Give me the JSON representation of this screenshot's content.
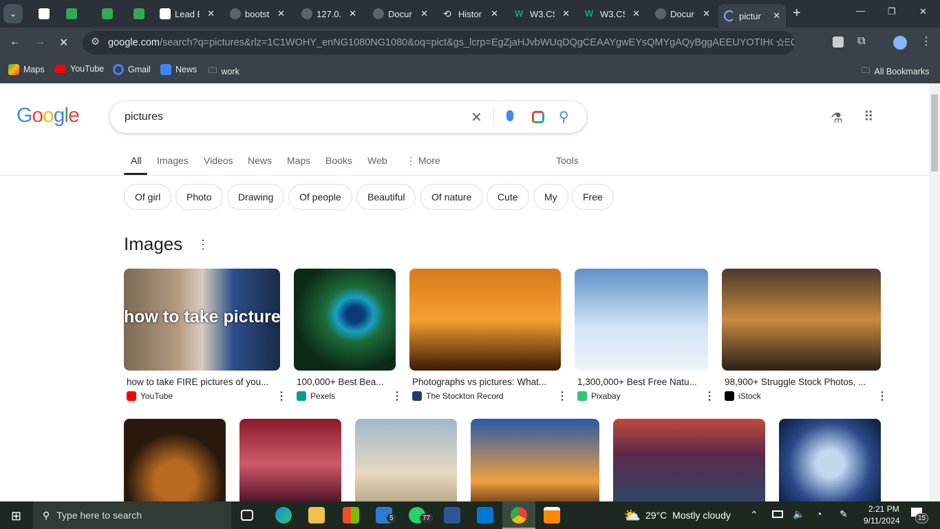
{
  "browser": {
    "tabs": [
      {
        "label": "",
        "icon": "adp-icon"
      },
      {
        "label": "",
        "icon": "sheets-icon"
      },
      {
        "label": "",
        "icon": "sheets-icon"
      },
      {
        "label": "",
        "icon": "sheets-icon"
      },
      {
        "label": "Lead E",
        "icon": "lead-icon"
      },
      {
        "label": "bootst",
        "icon": "globe-icon"
      },
      {
        "label": "127.0.",
        "icon": "globe-icon"
      },
      {
        "label": "Docur",
        "icon": "globe-icon"
      },
      {
        "label": "Histor",
        "icon": "history-icon"
      },
      {
        "label": "W3.CS",
        "icon": "w3-icon"
      },
      {
        "label": "W3.CS",
        "icon": "w3-icon"
      },
      {
        "label": "Docur",
        "icon": "globe-icon"
      },
      {
        "label": "pictur",
        "icon": "loading-icon"
      }
    ],
    "url_domain": "google.com",
    "url_path": "/search?q=pictures&rlz=1C1WOHY_enNG1080NG1080&oq=pict&gs_lcrp=EgZjaHJvbWUqDQgCEAAYgwEYsQMYgAQyBggAEEUYOTIHCAEQA...",
    "bookmarks": [
      "Maps",
      "YouTube",
      "Gmail",
      "News",
      "work"
    ],
    "all_bookmarks": "All Bookmarks"
  },
  "google": {
    "logo": "Google",
    "query": "pictures",
    "nav": [
      "All",
      "Images",
      "Videos",
      "News",
      "Maps",
      "Books",
      "Web",
      "More",
      "Tools"
    ],
    "chips": [
      "Of girl",
      "Photo",
      "Drawing",
      "Of people",
      "Beautiful",
      "Of nature",
      "Cute",
      "My",
      "Free"
    ],
    "images_heading": "Images",
    "row1": [
      {
        "caption": "how to take FIRE pictures of you...",
        "source": "YouTube",
        "overlay": "how to take pictures",
        "color": "#ff0000"
      },
      {
        "caption": "100,000+ Best Bea...",
        "source": "Pexels",
        "color": "#05a081"
      },
      {
        "caption": "Photographs vs pictures: What...",
        "source": "The Stockton Record",
        "color": "#1a3c6e"
      },
      {
        "caption": "1,300,000+ Best Free Natu...",
        "source": "Pixabay",
        "color": "#2ec66d"
      },
      {
        "caption": "98,900+ Struggle Stock Photos, ...",
        "source": "iStock",
        "color": "#000000"
      }
    ]
  },
  "taskbar": {
    "search_placeholder": "Type here to search",
    "weather": "29°C  Mostly cloudy",
    "time": "2:21 PM",
    "date": "9/11/2024",
    "notifications": "15",
    "mail_badge": "5",
    "whatsapp_badge": "77"
  }
}
